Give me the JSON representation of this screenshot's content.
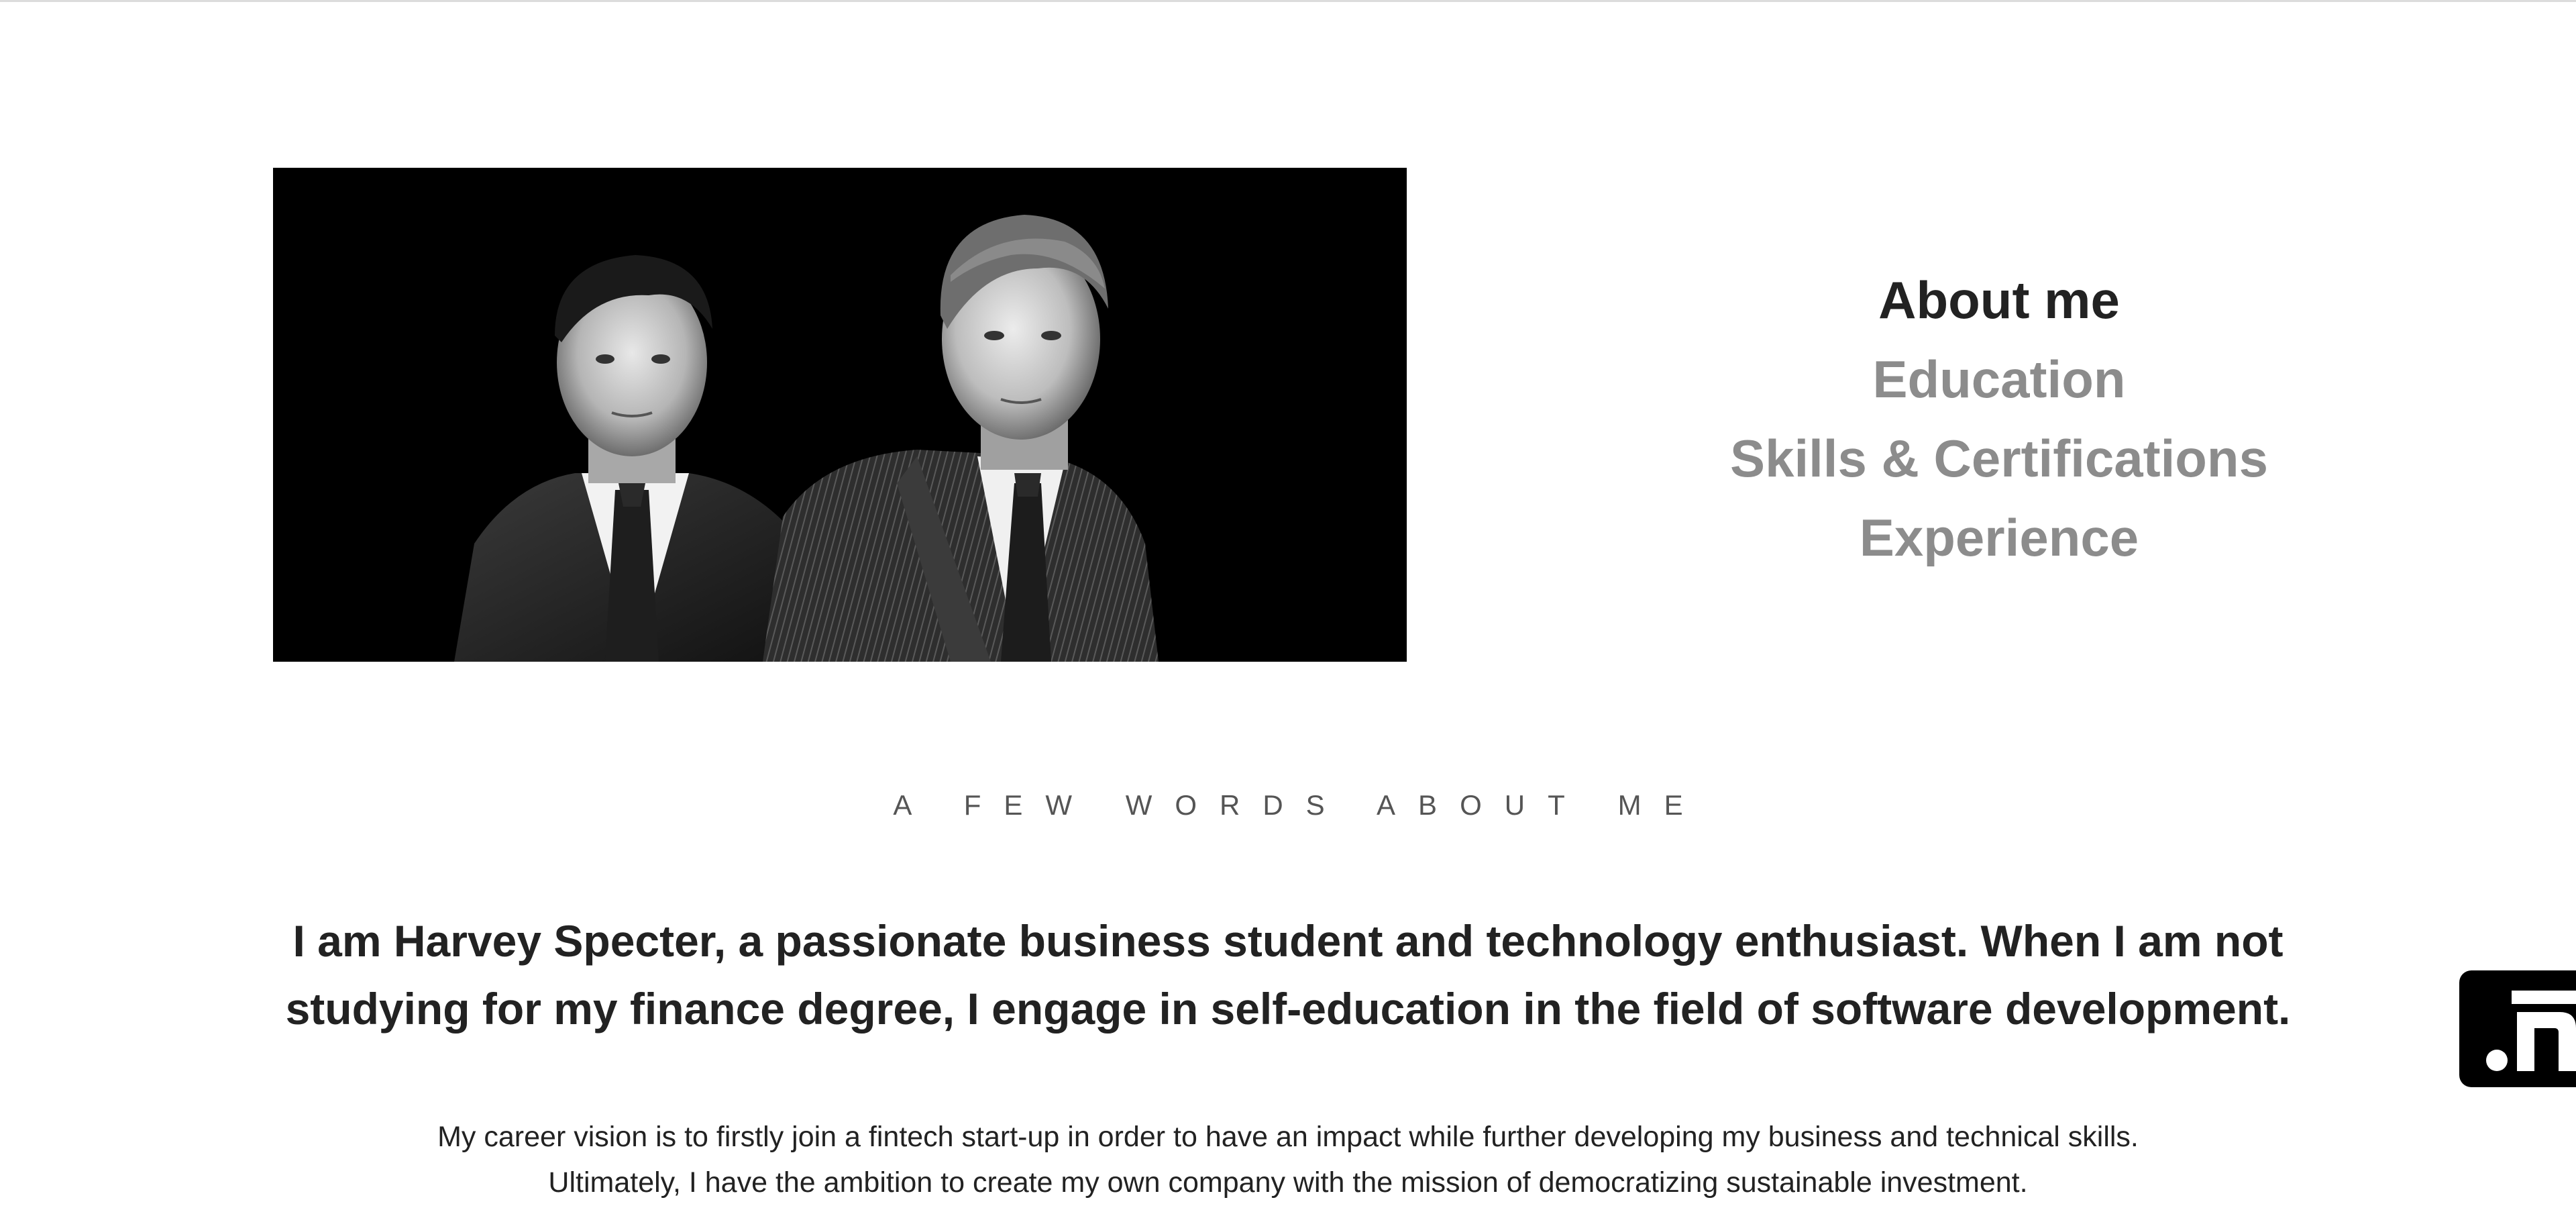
{
  "hero": {
    "image_description_icon": "portrait-photo-icon"
  },
  "nav": {
    "items": [
      {
        "label": "About me",
        "active": true
      },
      {
        "label": "Education",
        "active": false
      },
      {
        "label": "Skills & Certifications",
        "active": false
      },
      {
        "label": "Experience",
        "active": false
      }
    ]
  },
  "about": {
    "section_label": "A FEW WORDS ABOUT ME",
    "headline": "I am Harvey Specter, a passionate business student and technology enthusiast. When I am not studying for my finance degree, I engage in self-education in the field of software development.",
    "body_line_1": "My career vision is to firstly join a fintech start-up in order to have an impact while further developing my business and technical skills.",
    "body_line_2": "Ultimately, I have the ambition to create my own company with the mission of democratizing sustainable investment."
  },
  "side_badge": {
    "icon": "linkedin-in-icon"
  },
  "colors": {
    "active_nav": "#222222",
    "inactive_nav": "#8c8c8c",
    "label": "#555555",
    "photo_bg": "#000000"
  }
}
